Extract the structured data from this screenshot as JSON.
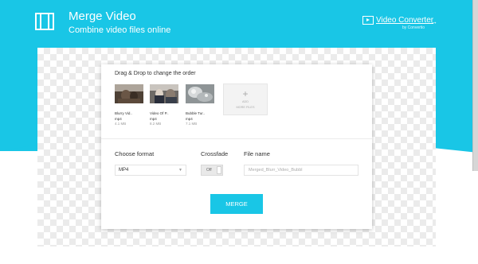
{
  "header": {
    "title": "Merge Video",
    "subtitle": "Combine video files online",
    "brand_link": "Video Converter",
    "brand_by": "by Convertio",
    "brand_arrow": "→"
  },
  "card": {
    "drag_label": "Drag & Drop to change the order",
    "files": [
      {
        "name": "Blurry Vid..",
        "ext": "mp4",
        "size": "4.1 MB"
      },
      {
        "name": "Video Of P..",
        "ext": "mp4",
        "size": "8.2 MB"
      },
      {
        "name": "Bubble Tur..",
        "ext": "mp4",
        "size": "7.1 MB"
      }
    ],
    "add_more": {
      "plus": "+",
      "label_line1": "ADD",
      "label_line2": "MORE FILES"
    },
    "format_label": "Choose format",
    "format_value": "MP4",
    "crossfade_label": "Crossfade",
    "crossfade_value": "Off",
    "filename_label": "File name",
    "filename_placeholder": "Merged_Blurr_Video_Bubbl",
    "merge_button": "MERGE"
  },
  "colors": {
    "accent": "#19c6e6"
  }
}
